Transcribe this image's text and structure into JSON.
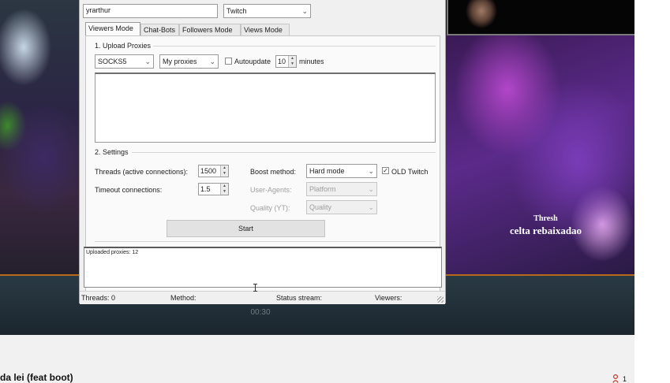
{
  "stream": {
    "champion_name": "Thresh",
    "champion_subtitle": "celta rebaixadao",
    "timer": "00:30"
  },
  "video": {
    "title": "da lei (feat boot)",
    "viewer_count": "1"
  },
  "dialog": {
    "username": "yrarthur",
    "platform": "Twitch",
    "tabs": [
      "Viewers Mode",
      "Chat-Bots",
      "Followers Mode",
      "Views Mode"
    ],
    "upload": {
      "group_label": "1. Upload Proxies",
      "proxy_type": "SOCKS5",
      "proxy_source": "My proxies",
      "autoupdate_label": "Autoupdate",
      "autoupdate_checked": false,
      "autoupdate_value": "10",
      "minutes_label": "minutes"
    },
    "settings": {
      "group_label": "2. Settings",
      "threads_label": "Threads (active connections):",
      "threads_value": "1500",
      "timeout_label": "Timeout connections:",
      "timeout_value": "1.5",
      "boost_label": "Boost method:",
      "boost_value": "Hard mode",
      "old_twitch_label": "OLD Twitch",
      "old_twitch_checked": true,
      "user_agents_label": "User-Agents:",
      "user_agents_value": "Platform",
      "quality_label": "Quality (YT):",
      "quality_value": "Quality"
    },
    "start_label": "Start",
    "log_text": "Uploaded proxies: 12",
    "status": {
      "threads": "Threads: 0",
      "method": "Method:",
      "status_stream": "Status stream:",
      "viewers": "Viewers:"
    }
  }
}
